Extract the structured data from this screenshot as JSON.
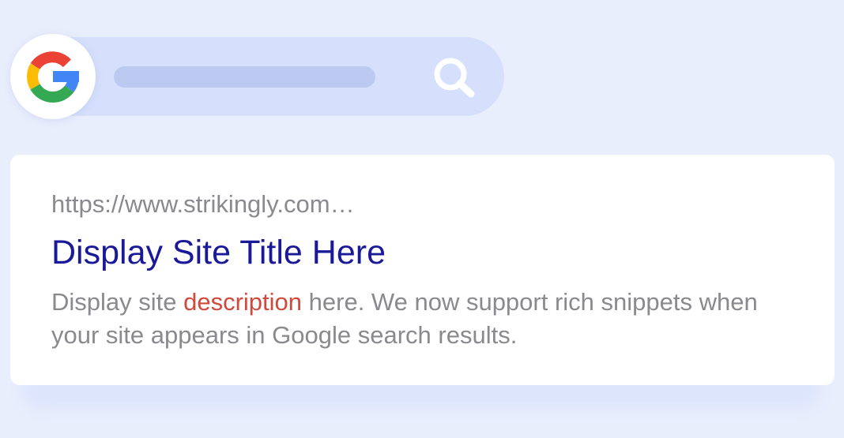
{
  "search_bar": {
    "logo_icon": "google-g-logo-icon",
    "search_icon": "search-icon",
    "background_color": "#d6e0fc",
    "query_placeholder_color": "#bccaf2"
  },
  "result": {
    "url": "https://www.strikingly.com…",
    "title": "Display Site Title Here",
    "description": {
      "before_highlight": "Display site ",
      "highlight": "description",
      "after_highlight": " here. We now support rich snippets when your site appears in Google search results."
    }
  },
  "colors": {
    "page_background": "#e9eefd",
    "title": "#1a1a98",
    "url_text": "#8a8a8e",
    "description_text": "#8a8a8e",
    "highlight_text": "#d04a3c",
    "google_blue": "#4285F4",
    "google_red": "#EA4335",
    "google_yellow": "#FBBC05",
    "google_green": "#34A853"
  }
}
